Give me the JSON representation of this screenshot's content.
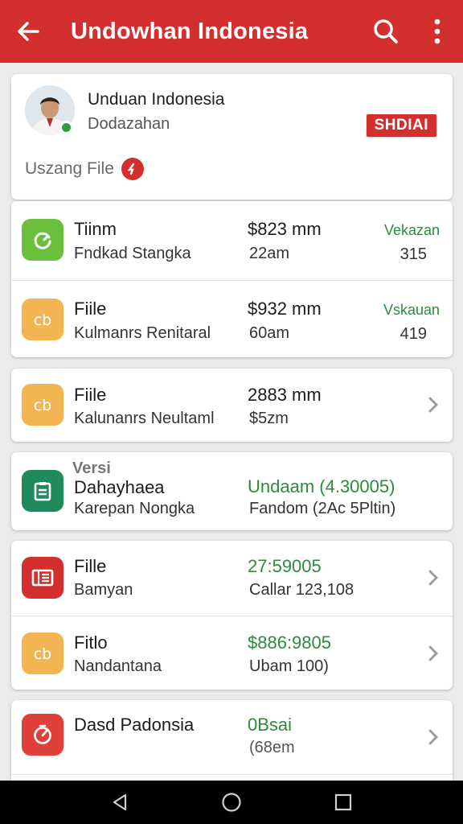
{
  "appbar": {
    "title": "Undowhan Indonesia",
    "color": "#d32f2f"
  },
  "icons": {
    "back": "arrow-back-icon",
    "search": "search-icon",
    "more": "more-vert-icon"
  },
  "profile": {
    "name": "Unduan Indonesia",
    "subtitle": "Dodazahan",
    "badge": "SHDIAI",
    "file_label": "Uszang File"
  },
  "card1": {
    "rows": [
      {
        "title": "Tiinm",
        "subtitle": "Fndkad Stangka",
        "amount": "$823 mm",
        "time": "22am",
        "status": "Vekazan",
        "count": "315",
        "icon_color": "#6cbf3c"
      },
      {
        "title": "Fiile",
        "subtitle": "Kulmanrs Renitaral",
        "amount": "$932 mm",
        "time": "60am",
        "status": "Vskauan",
        "count": "419",
        "icon_color": "#f2b552"
      }
    ]
  },
  "card2": {
    "row": {
      "title": "Fiile",
      "subtitle": "Kalunanrs Neultaml",
      "amount": "2883 mm",
      "time": "$5zm",
      "icon_color": "#f2b552"
    }
  },
  "card3": {
    "overline": "Versi",
    "title": "Dahayhaea",
    "subtitle": "Karepan Nongka",
    "version": "Undaam (4.30005)",
    "detail": "Fandom (2Ac 5Pltin)",
    "icon_color": "#1f8a5a"
  },
  "card4": {
    "rows": [
      {
        "title": "Fille",
        "subtitle": "Bamyan",
        "value": "27:59005",
        "detail": "Callar 123,108",
        "icon_color": "#d32f2f"
      },
      {
        "title": "Fitlo",
        "subtitle": "Nandantana",
        "value": "$886:9805",
        "detail": "Ubam 100)",
        "icon_color": "#f2b552"
      }
    ]
  },
  "card5": {
    "row": {
      "title": "Dasd Padonsia",
      "value": "0Bsai",
      "detail": "(68em",
      "icon_color": "#e0403a"
    }
  },
  "navbar": {
    "icons": [
      "nav-back-icon",
      "nav-home-icon",
      "nav-recents-icon"
    ]
  }
}
